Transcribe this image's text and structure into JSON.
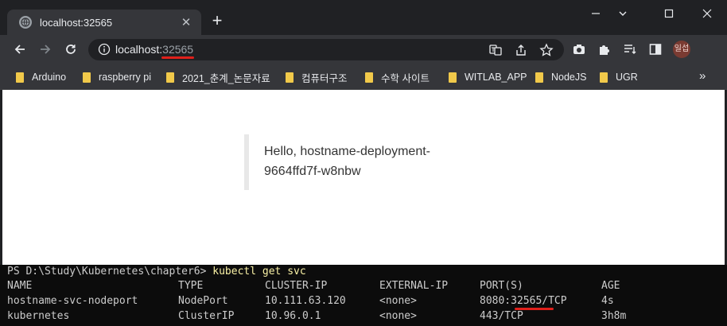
{
  "tab": {
    "title": "localhost:32565",
    "close": "✕",
    "new": "+"
  },
  "window": {
    "minimize": "minimize",
    "maximize": "maximize",
    "close": "close"
  },
  "address": {
    "host": "localhost:",
    "port": "32565"
  },
  "profile": {
    "initials": "일섭"
  },
  "bookmarks": [
    {
      "label": "Arduino"
    },
    {
      "label": "raspberry pi"
    },
    {
      "label": "2021_춘계_논문자료"
    },
    {
      "label": "컴퓨터구조"
    },
    {
      "label": "수학 사이트"
    },
    {
      "label": "WITLAB_APP"
    },
    {
      "label": "NodeJS"
    },
    {
      "label": "UGR"
    }
  ],
  "bookmarks_more": "»",
  "page": {
    "line1": "Hello, hostname-deployment-",
    "line2": "9664ffd7f-w8nbw"
  },
  "terminal": {
    "prompt": "PS D:\\Study\\Kubernetes\\chapter6> ",
    "command": "kubectl get svc",
    "headers": [
      "NAME",
      "TYPE",
      "CLUSTER-IP",
      "EXTERNAL-IP",
      "PORT(S)",
      "AGE"
    ],
    "rows": [
      [
        "hostname-svc-nodeport",
        "NodePort",
        "10.111.63.120",
        "<none>",
        "8080:32565/TCP",
        "4s"
      ],
      [
        "kubernetes",
        "ClusterIP",
        "10.96.0.1",
        "<none>",
        "443/TCP",
        "3h8m"
      ]
    ]
  },
  "colors": {
    "accent_underline": "#e0201b",
    "command": "#f9f1a5",
    "folder": "#f1c94a"
  }
}
